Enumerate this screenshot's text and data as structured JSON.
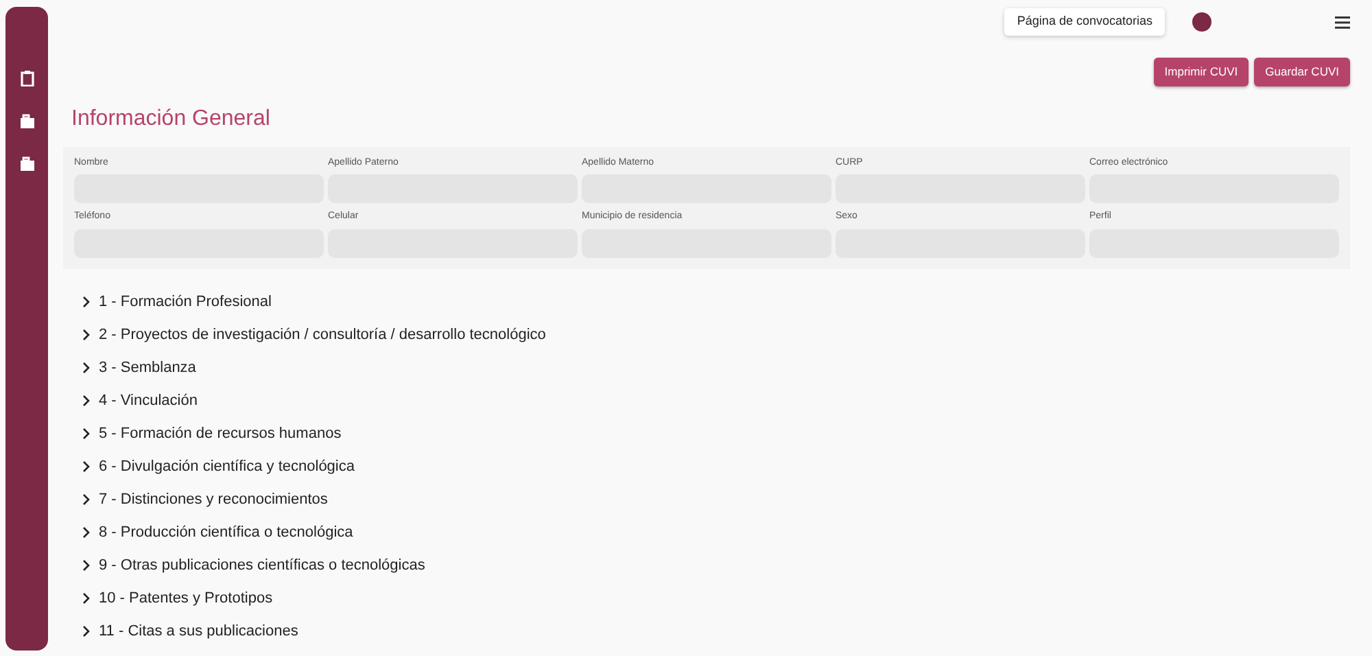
{
  "sidebar": {
    "items": [
      {
        "kind": "clipboard"
      },
      {
        "kind": "briefcase"
      },
      {
        "kind": "briefcase"
      }
    ]
  },
  "header": {
    "link_button": "Página de convocatorias"
  },
  "actions": [
    "Imprimir CUVI",
    "Guardar CUVI"
  ],
  "title": "Información General",
  "form": {
    "fields": [
      {
        "label": "Nombre"
      },
      {
        "label": "Apellido Paterno"
      },
      {
        "label": "Apellido Materno"
      },
      {
        "label": "CURP"
      },
      {
        "label": "Correo electrónico"
      },
      {
        "label": "Teléfono"
      },
      {
        "label": "Celular"
      },
      {
        "label": "Municipio de residencia"
      },
      {
        "label": "Sexo"
      },
      {
        "label": "Perfil"
      }
    ]
  },
  "sections": [
    {
      "label": "1 - Formación Profesional",
      "expanded": false
    },
    {
      "label": "2 - Proyectos de investigación / consultoría / desarrollo tecnológico",
      "expanded": false
    },
    {
      "label": "3 - Semblanza",
      "expanded": false
    },
    {
      "label": "4 - Vinculación",
      "expanded": false
    },
    {
      "label": "5 - Formación de recursos humanos",
      "expanded": false
    },
    {
      "label": "6 - Divulgación científica y tecnológica",
      "expanded": false
    },
    {
      "label": "7 - Distinciones y reconocimientos",
      "expanded": false
    },
    {
      "label": "8 - Producción científica o tecnológica",
      "expanded": false
    },
    {
      "label": "9 - Otras publicaciones científicas o tecnológicas",
      "expanded": false
    },
    {
      "label": "10 - Patentes y Prototipos",
      "expanded": false
    },
    {
      "label": "11 - Citas a sus publicaciones",
      "expanded": false
    }
  ]
}
